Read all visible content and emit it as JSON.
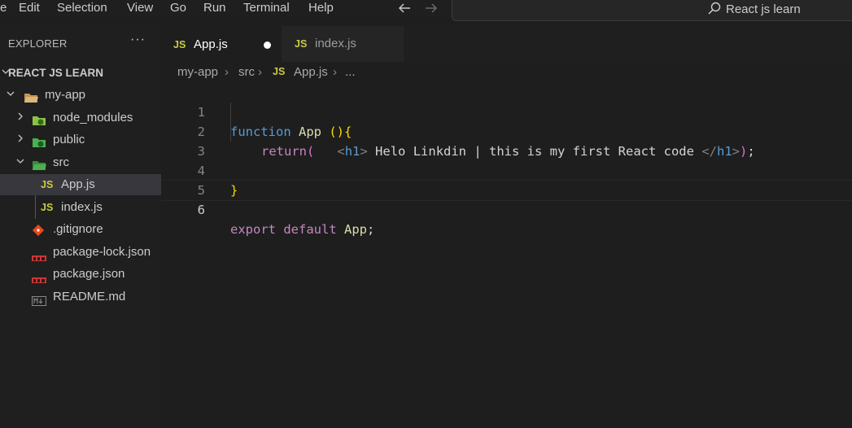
{
  "menu": [
    "e",
    "Edit",
    "Selection",
    "View",
    "Go",
    "Run",
    "Terminal",
    "Help"
  ],
  "nav": {
    "back_icon": "arrow-left-icon",
    "forward_icon": "arrow-right-icon"
  },
  "command_center": {
    "label": "React js learn",
    "icon": "search-icon"
  },
  "explorer": {
    "title": "EXPLORER",
    "more": "···",
    "root": "REACT JS LEARN",
    "items": [
      {
        "label": "my-app",
        "icon": "folder-open-icon"
      },
      {
        "label": "node_modules",
        "icon": "node-folder-icon"
      },
      {
        "label": "public",
        "icon": "public-folder-icon"
      },
      {
        "label": "src",
        "icon": "src-folder-icon"
      },
      {
        "label": "App.js",
        "badge": "JS"
      },
      {
        "label": "index.js",
        "badge": "JS"
      },
      {
        "label": ".gitignore",
        "icon": "git-icon"
      },
      {
        "label": "package-lock.json",
        "icon": "npm-icon"
      },
      {
        "label": "package.json",
        "icon": "npm-icon"
      },
      {
        "label": "README.md",
        "icon": "markdown-icon"
      }
    ]
  },
  "tabs": [
    {
      "badge": "JS",
      "label": "App.js",
      "dirty": true
    },
    {
      "badge": "JS",
      "label": "index.js",
      "dirty": false
    }
  ],
  "breadcrumb": {
    "parts": [
      "my-app",
      "src",
      "App.js",
      "..."
    ],
    "badge": "JS"
  },
  "editor": {
    "line_numbers": [
      "1",
      "2",
      "3",
      "4",
      "5",
      "6"
    ],
    "code": {
      "l1_kw": "function",
      "l1_fn": "App",
      "l1_paren": "()",
      "l1_brace": "{",
      "l2_return": "return",
      "l2_open": "(",
      "l2_tag_open_lt": "<",
      "l2_tag_open_name": "h1",
      "l2_tag_open_gt": ">",
      "l2_text": " Helo Linkdin | this is my first React code ",
      "l2_tag_close_lt": "</",
      "l2_tag_close_name": "h1",
      "l2_tag_close_gt": ">",
      "l2_close": ")",
      "l2_semi": ";",
      "l4_brace": "}",
      "l6_export": "export",
      "l6_default": "default",
      "l6_name": "App",
      "l6_semi": ";"
    }
  },
  "colors": {
    "background": "#1e1e1e",
    "sidebar": "#1f1f1f",
    "keyword": "#569cd6",
    "function": "#dcdcaa",
    "control": "#c586c0",
    "bracket": "#ffd700",
    "js_badge": "#cbcb41"
  }
}
